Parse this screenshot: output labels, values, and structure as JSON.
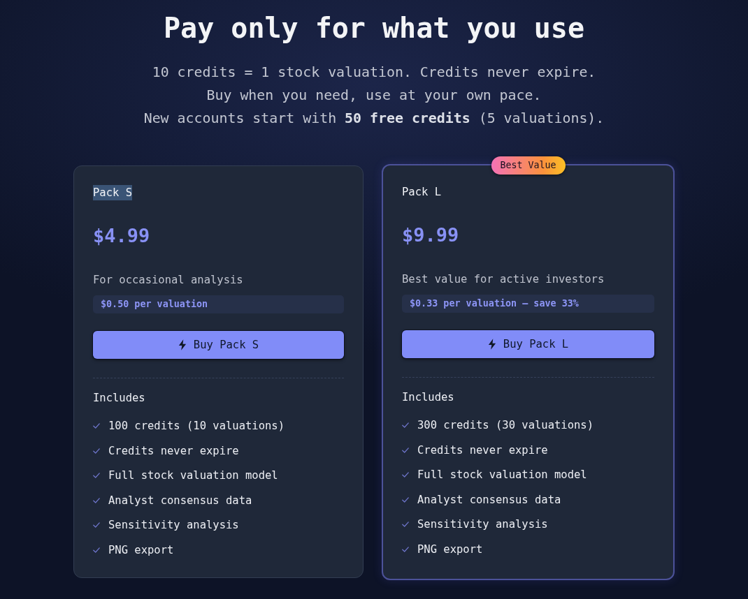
{
  "heading": "Pay only for what you use",
  "intro_lines": [
    "10 credits = 1 stock valuation. Credits never expire.",
    "Buy when you need, use at your own pace.",
    "New accounts start with **50 free credits** (5 valuations)."
  ],
  "packs": [
    {
      "name": "Pack S",
      "name_highlighted": true,
      "featured": false,
      "price": "$4.99",
      "tagline": "For occasional analysis",
      "unit_price": "$0.50 per valuation",
      "button": "Buy Pack S",
      "includes_label": "Includes",
      "features": [
        "100 credits (10 valuations)",
        "Credits never expire",
        "Full stock valuation model",
        "Analyst consensus data",
        "Sensitivity analysis",
        "PNG export"
      ]
    },
    {
      "badge": "Best Value",
      "name": "Pack L",
      "name_highlighted": false,
      "featured": true,
      "price": "$9.99",
      "tagline": "Best value for active investors",
      "unit_price": "$0.33 per valuation — save 33%",
      "button": "Buy Pack L",
      "includes_label": "Includes",
      "features": [
        "300 credits (30 valuations)",
        "Credits never expire",
        "Full stock valuation model",
        "Analyst consensus data",
        "Sensitivity analysis",
        "PNG export"
      ]
    }
  ]
}
